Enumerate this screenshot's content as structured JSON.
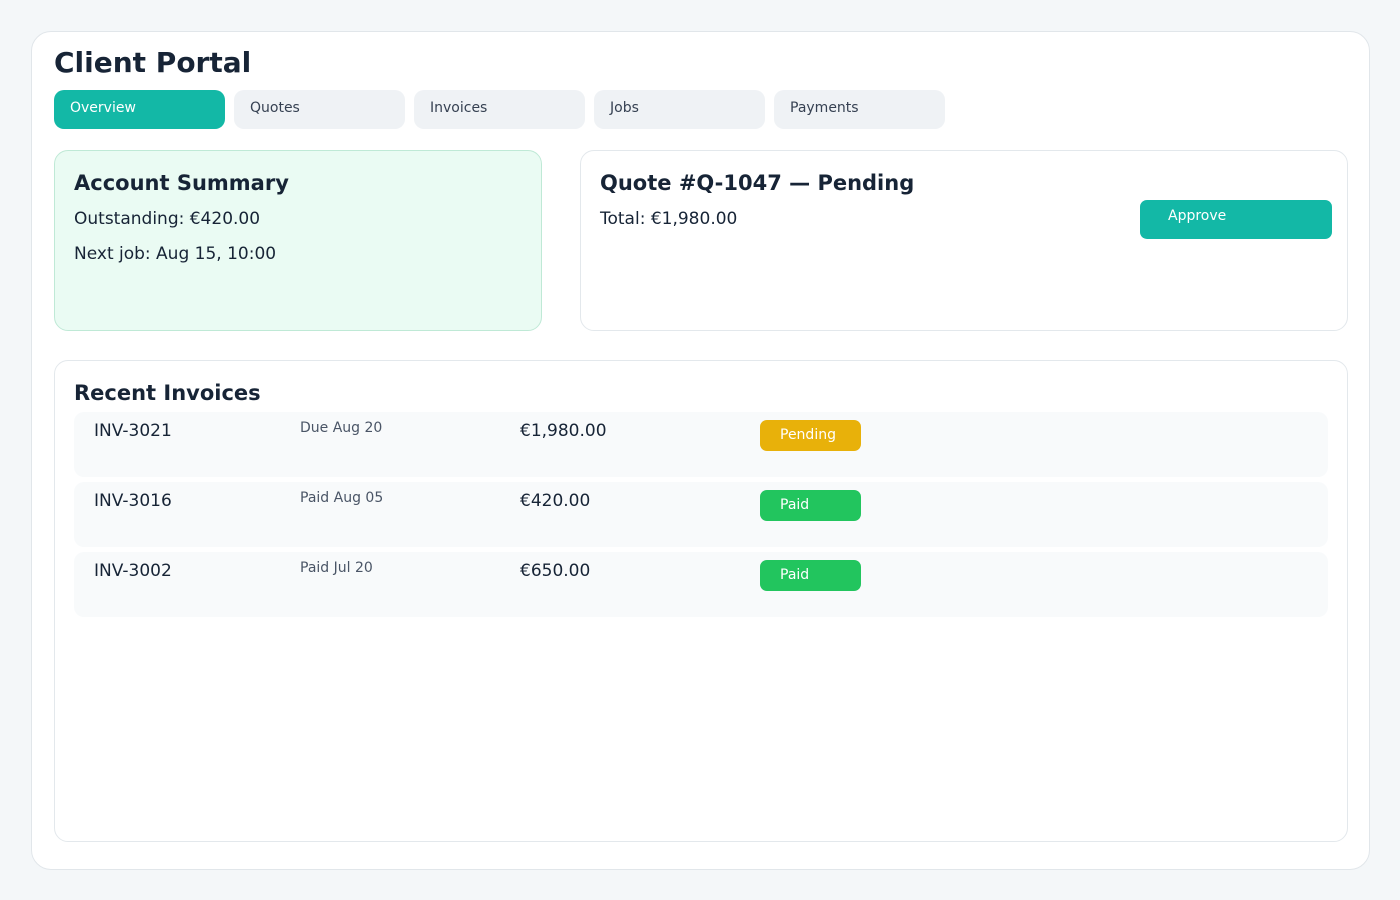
{
  "header": {
    "title": "Client Portal"
  },
  "tabs": [
    {
      "label": "Overview",
      "active": true
    },
    {
      "label": "Quotes",
      "active": false
    },
    {
      "label": "Invoices",
      "active": false
    },
    {
      "label": "Jobs",
      "active": false
    },
    {
      "label": "Payments",
      "active": false
    }
  ],
  "summary": {
    "title": "Account Summary",
    "outstanding": "Outstanding: €420.00",
    "next_job": "Next job: Aug 15, 10:00"
  },
  "quote": {
    "title": "Quote #Q-1047 — Pending",
    "total": "Total: €1,980.00",
    "approve_label": "Approve"
  },
  "invoices": {
    "title": "Recent Invoices",
    "rows": [
      {
        "id": "INV-3021",
        "date": "Due Aug 20",
        "amount": "€1,980.00",
        "status": "Pending",
        "status_color": "#e8b10a"
      },
      {
        "id": "INV-3016",
        "date": "Paid Aug 05",
        "amount": "€420.00",
        "status": "Paid",
        "status_color": "#22c55e"
      },
      {
        "id": "INV-3002",
        "date": "Paid Jul 20",
        "amount": "€650.00",
        "status": "Paid",
        "status_color": "#22c55e"
      }
    ]
  },
  "colors": {
    "accent": "#13b8a6",
    "pending": "#e8b10a",
    "paid": "#22c55e"
  }
}
